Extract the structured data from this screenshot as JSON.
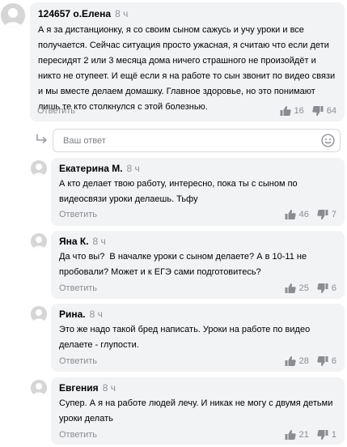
{
  "main_comment": {
    "author": "124657 о.Елена",
    "time": "8 ч",
    "lines": [
      "А я за дистанционку, я со своим сыном сажусь и учу уроки и все",
      "получается. Сейчас ситуация просто ужасная, я считаю что если дети",
      "пересидят 2 или 3 месяца дома ничего страшного не произойдёт и",
      "никто не отупеет. И ещё если я на работе то сын звонит по видео связи",
      "и мы вместе делаем домашку. Главное здоровье, но это понимают",
      "лишь те кто столкнулся с этой болезнью."
    ],
    "reply_label": "Ответить",
    "likes": "16",
    "dislikes": "64"
  },
  "reply_input": {
    "placeholder": "Ваш ответ",
    "value": ""
  },
  "replies": [
    {
      "author": "Екатерина М.",
      "time": "8 ч",
      "lines": [
        "А кто делает твою работу, интересно, пока ты с сыном по",
        "видеосвязи уроки делаешь. Тьфу"
      ],
      "reply_label": "Ответить",
      "likes": "46",
      "dislikes": "7"
    },
    {
      "author": "Яна К.",
      "time": "8 ч",
      "lines": [
        "Да что вы?  В началке уроки с сыном делаете? А в 10-11 не",
        "пробовали? Может и к ЕГЭ сами подготовитесь?"
      ],
      "reply_label": "Ответить",
      "likes": "25",
      "dislikes": "6"
    },
    {
      "author": "Рина.",
      "time": "8 ч",
      "lines": [
        "Это же надо такой бред написать. Уроки на работе по видео",
        "делаете - глупости."
      ],
      "reply_label": "Ответить",
      "likes": "28",
      "dislikes": "6"
    },
    {
      "author": "Евгения",
      "time": "8 ч",
      "lines": [
        "Супер. А я на работе людей лечу. И никак не могу с двумя детьми",
        "уроки делать"
      ],
      "reply_label": "Ответить",
      "likes": "21",
      "dislikes": "1"
    }
  ],
  "colors": {
    "card_bg": "#f2f3f5",
    "muted_text": "#8a8c91",
    "avatar_bg": "#d6d6d6"
  }
}
